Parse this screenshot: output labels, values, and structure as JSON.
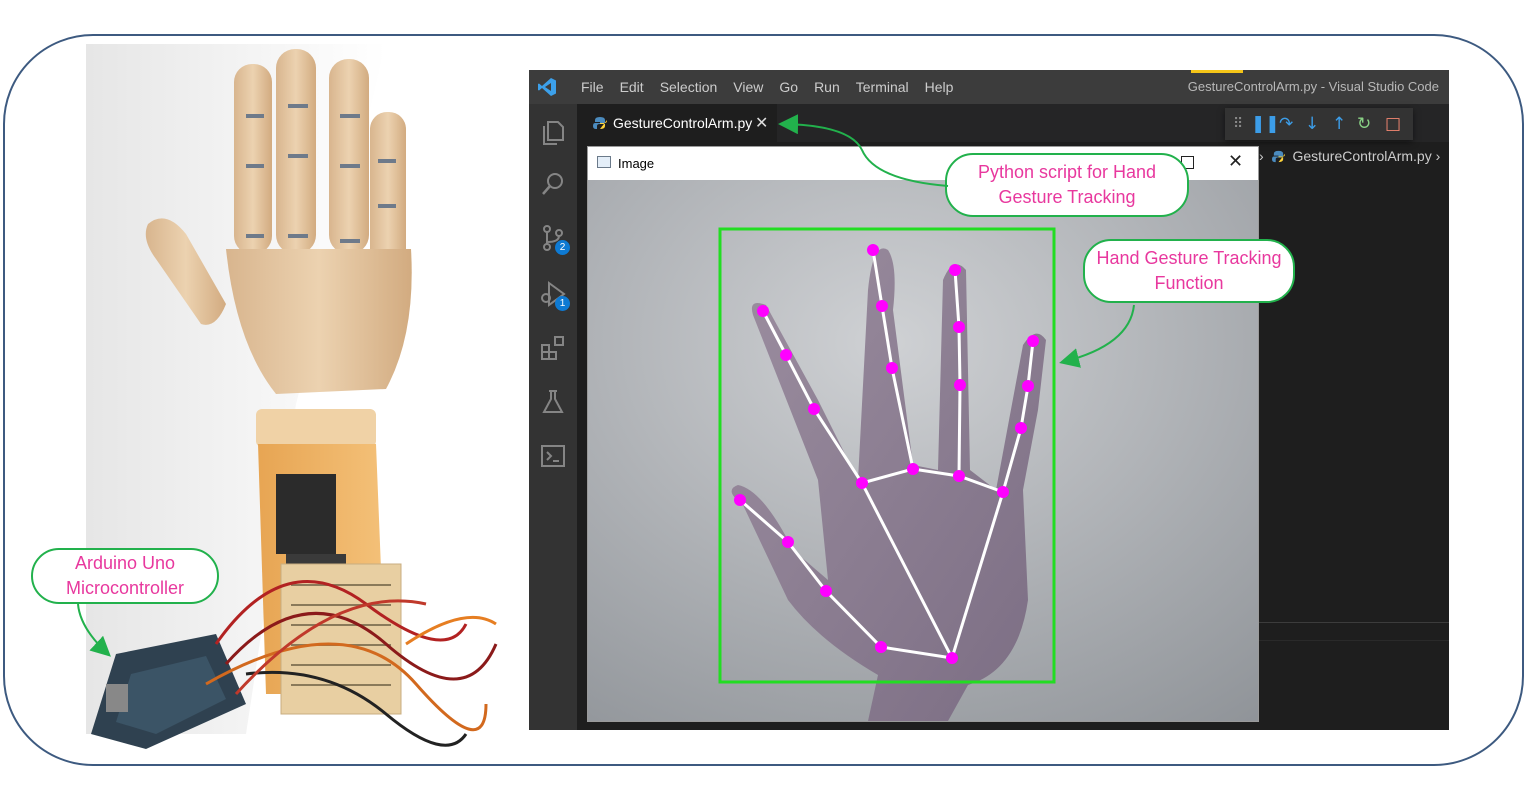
{
  "vscode": {
    "menu": [
      "File",
      "Edit",
      "Selection",
      "View",
      "Go",
      "Run",
      "Terminal",
      "Help"
    ],
    "window_title": "GestureControlArm.py - Visual Studio Code",
    "tab_label": "GestureControlArm.py",
    "tab_close": "✕",
    "breadcrumb_file": "GestureControlArm.py",
    "breadcrumb_sep": "›",
    "activity_icons": [
      "explorer-icon",
      "search-icon",
      "source-control-icon",
      "run-debug-icon",
      "extensions-icon",
      "testing-icon",
      "terminal-icon"
    ],
    "source_control_badge": "2",
    "debug_badge": "1",
    "debug_toolbar": [
      "grip-icon",
      "pause-icon",
      "step-over-icon",
      "step-into-icon",
      "step-out-icon",
      "restart-icon",
      "stop-icon"
    ]
  },
  "image_window": {
    "title": "Image",
    "close": "✕"
  },
  "callouts": {
    "python_script": "Python script for Hand Gesture Tracking",
    "hand_tracking": "Hand Gesture Tracking Function",
    "arduino": "Arduino Uno Microcontroller"
  },
  "colors": {
    "frame": "#3d5a80",
    "callout_border": "#22b14c",
    "callout_text": "#e8389e",
    "landmark": "#ff00ff",
    "bbox": "#22dd22",
    "vscode_bg": "#1e1e1e",
    "vscode_activity": "#333333"
  }
}
